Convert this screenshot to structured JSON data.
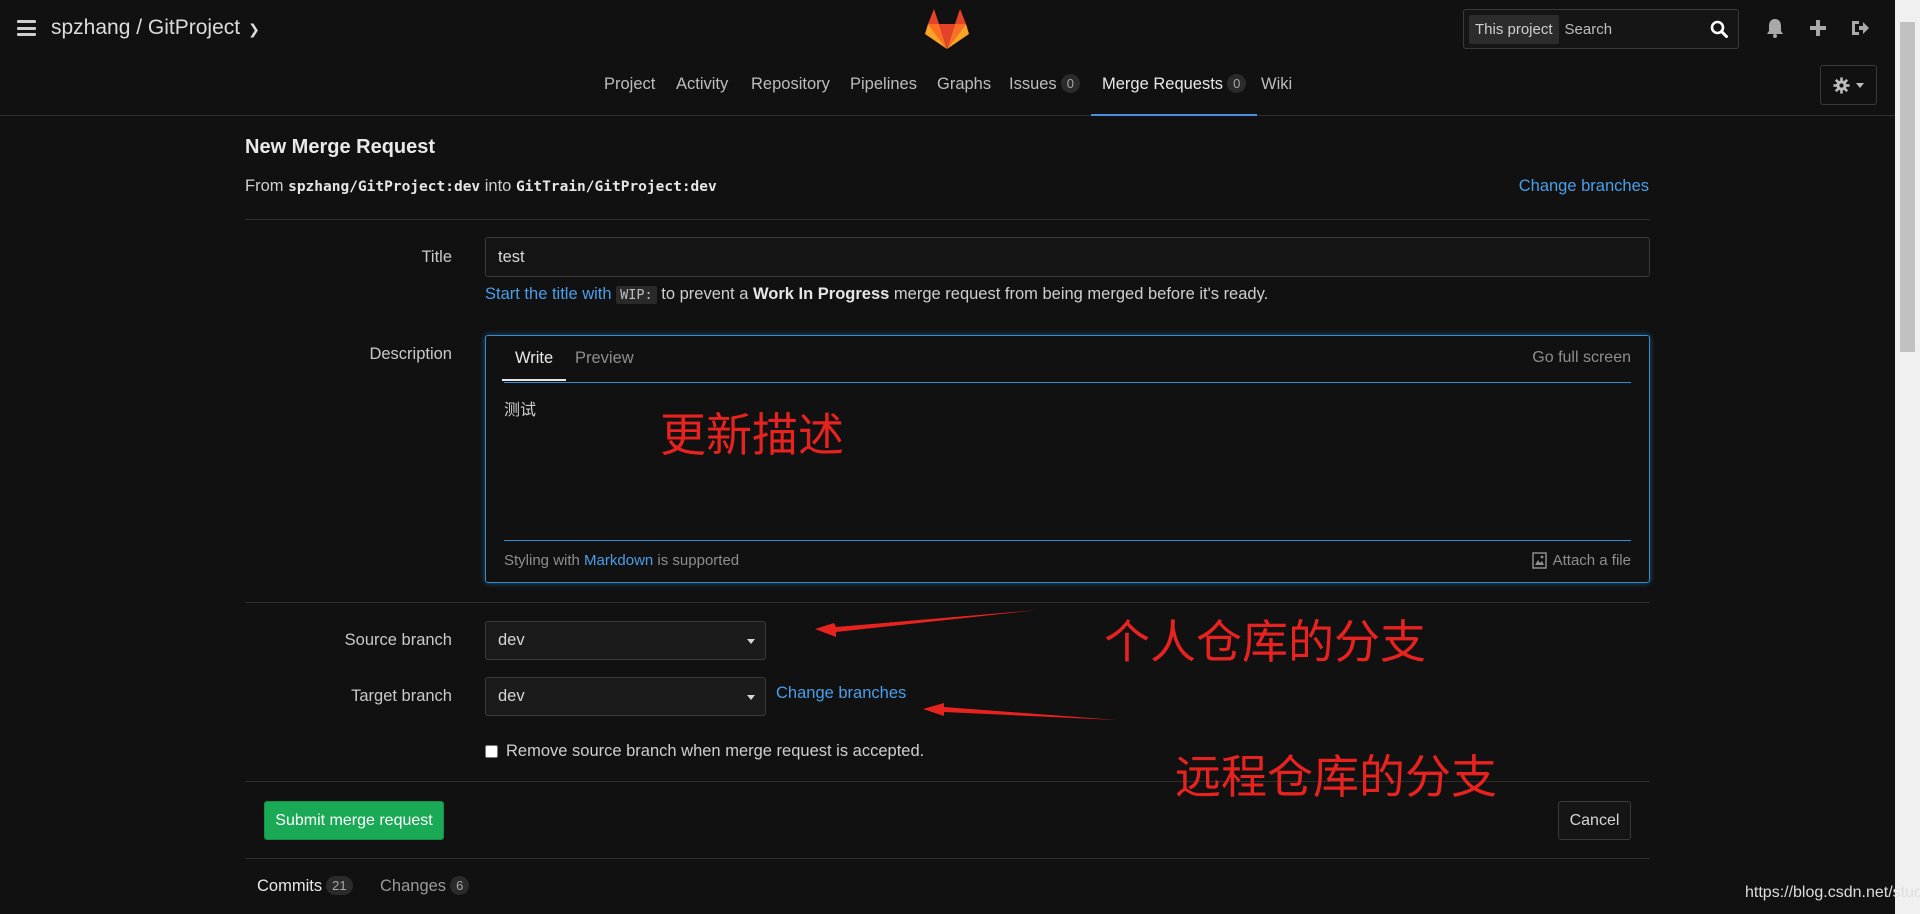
{
  "header": {
    "project_path": "spzhang / GitProject",
    "search_scope": "This project",
    "search_placeholder": "Search"
  },
  "nav": {
    "tabs": [
      {
        "label": "Project"
      },
      {
        "label": "Activity"
      },
      {
        "label": "Repository"
      },
      {
        "label": "Pipelines"
      },
      {
        "label": "Graphs"
      },
      {
        "label": "Issues",
        "count": "0"
      },
      {
        "label": "Merge Requests",
        "count": "0"
      },
      {
        "label": "Wiki"
      }
    ],
    "active": "Merge Requests"
  },
  "form": {
    "heading": "New Merge Request",
    "from_prefix": "From",
    "source_ref": "spzhang/GitProject:dev",
    "into_word": "into",
    "target_ref": "GitTrain/GitProject:dev",
    "change_branches": "Change branches",
    "title_label": "Title",
    "title_value": "test",
    "wip_hint_link": "Start the title with",
    "wip_code": "WIP:",
    "wip_hint_mid": "to prevent a",
    "wip_bold": "Work In Progress",
    "wip_hint_end": "merge request from being merged before it's ready.",
    "description_label": "Description",
    "write_tab": "Write",
    "preview_tab": "Preview",
    "full_screen": "Go full screen",
    "description_value": "测试",
    "styling_prefix": "Styling with",
    "markdown_link": "Markdown",
    "styling_suffix": "is supported",
    "attach_file": "Attach a file",
    "source_branch_label": "Source branch",
    "source_branch_value": "dev",
    "target_branch_label": "Target branch",
    "target_branch_value": "dev",
    "remove_source_label": "Remove source branch when merge request is accepted.",
    "submit_label": "Submit merge request",
    "cancel_label": "Cancel"
  },
  "bottom_tabs": {
    "commits_label": "Commits",
    "commits_count": "21",
    "changes_label": "Changes",
    "changes_count": "6"
  },
  "annotations": {
    "update_desc": "更新描述",
    "personal_branch": "个人仓库的分支",
    "remote_branch": "远程仓库的分支",
    "color": "#e8231f"
  },
  "watermark": "https://blog.csdn.net/studio_",
  "colors": {
    "background": "#111111",
    "link": "#4a9eea",
    "submit": "#1aaa55",
    "focus": "#2f8ed4"
  }
}
